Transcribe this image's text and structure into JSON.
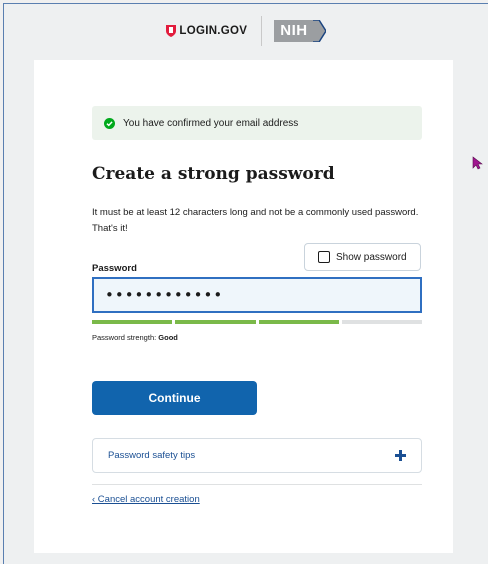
{
  "header": {
    "login_logo_text": "LOGIN.GOV",
    "partner_logo_text": "NIH",
    "shield_icon": "shield-icon",
    "brand_color": "#e21c3d"
  },
  "alert": {
    "icon": "check-circle-icon",
    "message": "You have confirmed your email address",
    "color": "#00a91c"
  },
  "form": {
    "title": "Create a strong password",
    "intro": "It must be at least 12 characters long and not be a commonly used password. That's it!",
    "show_password_label": "Show password",
    "show_password_checked": false,
    "password_label": "Password",
    "password_value": "••••••••••••",
    "strength_label": "Password strength:",
    "strength_value": "Good",
    "strength_level": 3,
    "strength_max": 4,
    "strength_color": "#7ab949",
    "strength_empty_color": "#dfe1e2",
    "continue_label": "Continue",
    "primary_color": "#1164ad"
  },
  "tips": {
    "label": "Password safety tips",
    "icon": "plus-icon"
  },
  "footer": {
    "cancel_link": "‹ Cancel account creation"
  },
  "cursor": {
    "icon": "mouse-pointer-icon",
    "color": "#a0168f"
  }
}
